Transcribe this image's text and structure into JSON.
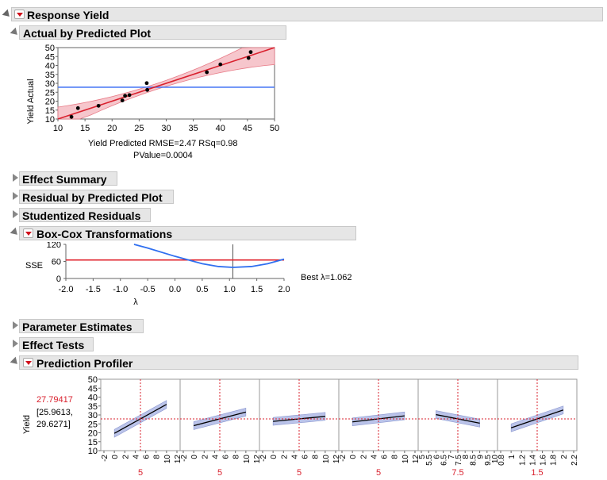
{
  "report": {
    "title": "Response Yield"
  },
  "actual_by_predicted": {
    "title": "Actual by Predicted Plot",
    "stats_line1": "Yield Predicted RMSE=2.47 RSq=0.98",
    "stats_line2": "PValue=0.0004",
    "chart_data": {
      "type": "scatter",
      "xlabel": "Yield Predicted",
      "ylabel": "Yield Actual",
      "xlim": [
        10,
        50
      ],
      "ylim": [
        10,
        50
      ],
      "x_ticks": [
        10,
        15,
        20,
        25,
        30,
        35,
        40,
        45,
        50
      ],
      "y_ticks": [
        10,
        15,
        20,
        25,
        30,
        35,
        40,
        45,
        50
      ],
      "points": [
        [
          12.5,
          11.2
        ],
        [
          13.7,
          16.1
        ],
        [
          17.5,
          17.4
        ],
        [
          21.9,
          20.4
        ],
        [
          22.4,
          23.0
        ],
        [
          23.2,
          23.4
        ],
        [
          26.4,
          30.1
        ],
        [
          26.5,
          26.3
        ],
        [
          37.5,
          36.2
        ],
        [
          40.0,
          40.6
        ],
        [
          45.2,
          44.2
        ],
        [
          45.6,
          47.5
        ]
      ],
      "mean_line": 27.8,
      "fit_color": "#d9212e",
      "band_color": "#f4b8bf",
      "mean_color": "#4f7df5"
    }
  },
  "collapsed_sections": {
    "effect_summary": "Effect Summary",
    "residual_by_predicted": "Residual by Predicted Plot",
    "studentized_residuals": "Studentized Residuals",
    "parameter_estimates": "Parameter Estimates",
    "effect_tests": "Effect Tests"
  },
  "box_cox": {
    "title": "Box-Cox Transformations",
    "best_label": "Best λ=1.062",
    "chart_data": {
      "type": "line",
      "xlabel": "λ",
      "ylabel": "SSE",
      "xlim": [
        -2.0,
        2.0
      ],
      "ylim": [
        0,
        120
      ],
      "x_ticks": [
        "-2.0",
        "-1.5",
        "-1.0",
        "-0.5",
        "0.0",
        "0.5",
        "1.0",
        "1.5",
        "2.0"
      ],
      "y_ticks": [
        0,
        60,
        120
      ],
      "best_lambda": 1.062,
      "ci_line": 65,
      "curve": [
        [
          -0.75,
          120
        ],
        [
          -0.5,
          107
        ],
        [
          0.0,
          78
        ],
        [
          0.5,
          52
        ],
        [
          0.8,
          42
        ],
        [
          1.062,
          39
        ],
        [
          1.4,
          42
        ],
        [
          1.7,
          52
        ],
        [
          2.0,
          68
        ]
      ],
      "curve_color": "#2f6ff0",
      "ci_color": "#e0242f"
    }
  },
  "profiler": {
    "title": "Prediction Profiler",
    "ylabel": "Yield",
    "value": "27.79417",
    "ci_low": "[25.9613,",
    "ci_high": "29.6271]",
    "y_ticks": [
      10,
      15,
      20,
      25,
      30,
      35,
      40,
      45,
      50
    ],
    "chart_data": {
      "type": "line",
      "ylim": [
        10,
        50
      ],
      "current_y": 27.79417,
      "panels": [
        {
          "xlim": [
            -2,
            12
          ],
          "ticks": [
            "-2",
            "0",
            "2",
            "4",
            "6",
            "8",
            "10",
            "12"
          ],
          "current": "5",
          "cur": 5,
          "line": [
            [
              0,
              19.7
            ],
            [
              10,
              35.9
            ]
          ]
        },
        {
          "xlim": [
            -2,
            12
          ],
          "ticks": [
            "-2",
            "0",
            "2",
            "4",
            "6",
            "8",
            "10",
            "12"
          ],
          "current": "5",
          "cur": 5,
          "line": [
            [
              0,
              24.0
            ],
            [
              10,
              31.6
            ]
          ]
        },
        {
          "xlim": [
            -2,
            12
          ],
          "ticks": [
            "-2",
            "0",
            "2",
            "4",
            "6",
            "8",
            "10",
            "12"
          ],
          "current": "5",
          "cur": 5,
          "line": [
            [
              0,
              26.4
            ],
            [
              10,
              29.2
            ]
          ]
        },
        {
          "xlim": [
            -2,
            12
          ],
          "ticks": [
            "-2",
            "0",
            "2",
            "4",
            "6",
            "8",
            "10",
            "12"
          ],
          "current": "5",
          "cur": 5,
          "line": [
            [
              0,
              26.1
            ],
            [
              10,
              29.5
            ]
          ]
        },
        {
          "xlim": [
            5,
            10
          ],
          "ticks": [
            "5",
            "5.5",
            "6",
            "6.5",
            "7",
            "7.5",
            "8",
            "8.5",
            "9",
            "9.5",
            "10"
          ],
          "current": "7.5",
          "cur": 7.5,
          "line": [
            [
              6,
              30.2
            ],
            [
              9,
              25.4
            ]
          ]
        },
        {
          "xlim": [
            0.8,
            2.2
          ],
          "ticks": [
            "0.8",
            "1",
            "1.2",
            "1.4",
            "1.6",
            "1.8",
            "2",
            "2.2"
          ],
          "current": "1.5",
          "cur": 1.5,
          "line": [
            [
              1.0,
              22.8
            ],
            [
              2.0,
              32.8
            ]
          ]
        }
      ],
      "line_color": "#000000",
      "band_color": "#a9b4e3",
      "ref_color": "#d9212e"
    }
  }
}
